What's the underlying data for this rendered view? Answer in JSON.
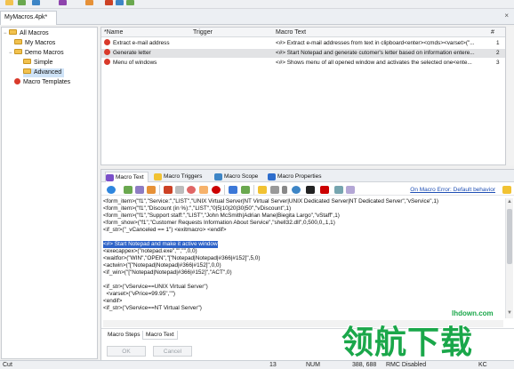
{
  "document_tab": {
    "label": "MyMacros.4pk*",
    "close": "×"
  },
  "tree": {
    "items": [
      {
        "label": "All Macros",
        "kind": "folder",
        "expander": "−"
      },
      {
        "label": "My Macros",
        "kind": "folder",
        "expander": ""
      },
      {
        "label": "Demo Macros",
        "kind": "folder-macro",
        "expander": "−"
      },
      {
        "label": "Simple",
        "kind": "folder",
        "expander": ""
      },
      {
        "label": "Advanced",
        "kind": "folder",
        "expander": "",
        "selected": true
      },
      {
        "label": "Macro Templates",
        "kind": "macro",
        "expander": ""
      }
    ]
  },
  "macro_list": {
    "columns": [
      "*Name",
      "Trigger",
      "Macro Text",
      "#"
    ],
    "rows": [
      {
        "name": "Extract e-mail address",
        "trigger": "",
        "text": "<#> Extract e-mail addresses from text in clipboard<enter><cmds><varset>(\"...",
        "num": "1"
      },
      {
        "name": "Generate letter",
        "trigger": "",
        "text": "<#> Start Notepad and generate cutomer's letter based on information entere...",
        "num": "2"
      },
      {
        "name": "Menu of windows",
        "trigger": "",
        "text": "<#> Shows menu of all opened window and activates the selected one<ente...",
        "num": "3"
      }
    ]
  },
  "editor": {
    "tabs": [
      "Macro Text",
      "Macro Triggers",
      "Macro Scope",
      "Macro Properties"
    ],
    "error_link": "On Macro Error: Default behavior",
    "code_lines": [
      {
        "text": "<form_item>(\"f1\",\"Service:\",\"LIST\",\"UNIX Virtual Server|NT Virtual Server|UNIX Dedicated Server|NT Dedicated Server\",\"vService\",1)",
        "hl": false
      },
      {
        "text": "<form_item>(\"f1\",\"Discount (in %):\",\"LIST\",\"0|5|10|20|30|50\",\"vDiscount\",1)",
        "hl": false
      },
      {
        "text": "<form_item>(\"f1\",\"Support staff:\",\"LIST\",\"John McSmith|Adrian Mane|Biegita Largo\",\"vStaff\",1)",
        "hl": false
      },
      {
        "text": "<form_show>(\"f1\",\"Customer Requests Information About Service\",\"shell32.dll\",0,500,0,,1,1)",
        "hl": false
      },
      {
        "text": "<if_str>(\"_vCanceled == 1\") <exitmacro> <endif>",
        "hl": false
      },
      {
        "text": "",
        "hl": false
      },
      {
        "text": "<#> Start Notepad and make it active window",
        "hl": true
      },
      {
        "text": "<execappex>(\"notepad.exe\",\"\",\"\",0,0)",
        "hl": false
      },
      {
        "text": "<waitfor>(\"WIN\",\"OPEN\",\"[\"Notepad|Notepad|#366|#152]\",5,0)",
        "hl": false
      },
      {
        "text": "<actwin>(\"[\"Notepad|Notepad|#366|#152]\",0,0)",
        "hl": false
      },
      {
        "text": "<if_win>(\"[\"Notepad|Notepad|#366|#152]\",\"ACT\",0)",
        "hl": false
      },
      {
        "text": "",
        "hl": false
      },
      {
        "text": "<if_str>(\"vService==UNIX Virtual Server\")",
        "hl": false
      },
      {
        "text": "  <varset>(\"vPrice=99.95\",\"\")",
        "hl": false
      },
      {
        "text": "<endif>",
        "hl": false
      },
      {
        "text": "<if_str>(\"vService==NT Virtual Server\")",
        "hl": false
      }
    ],
    "bottom_tabs": [
      "Macro Steps",
      "Macro Text"
    ],
    "ok_label": "OK",
    "cancel_label": "Cancel"
  },
  "status_bar": {
    "left": "Cut",
    "count": "13",
    "num": "NUM",
    "coords": "388, 688",
    "rmc": "RMC Disabled",
    "kc": "KC"
  },
  "watermark": {
    "url": "lhdown.com",
    "text": "领航下载"
  }
}
